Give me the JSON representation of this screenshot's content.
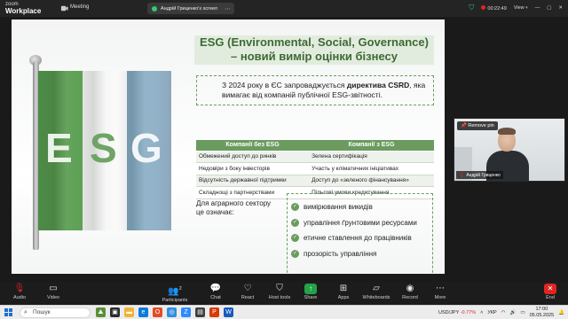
{
  "app": {
    "logo_line1": "zoom",
    "logo_line2": "Workplace",
    "meeting_label": "Meeting",
    "share_tab_label": "Андрій Гриценко's screen",
    "timer": "00:22:49",
    "view_label": "View",
    "colors": {
      "share_green": "#22a34a",
      "end_red": "#e02424",
      "accent_green": "#6b9b5f"
    }
  },
  "slide": {
    "title_line1": "ESG (Environmental, Social, Governance)",
    "title_line2": "– новий вимір оцінки бізнесу",
    "callout_pre": "З 2024 року в ЄС запроваджується ",
    "callout_bold": "директива CSRD",
    "callout_post": ", яка вимагає від компаній публічної ESG-звітності.",
    "flag_letters": [
      "E",
      "S",
      "G"
    ],
    "table": {
      "headers": [
        "Компанії без ESG",
        "Компанії з ESG"
      ],
      "rows": [
        [
          "Обмежений доступ до ринків",
          "Зелена сертифікація"
        ],
        [
          "Недовіри з боку інвесторів",
          "Участь у кліматичних ініціативах"
        ],
        [
          "Відсутність державної підтримки",
          "Доступ до «зеленого фінансування»"
        ],
        [
          "Складнощі з партнерствами",
          "Пільгові умови кредитування"
        ]
      ]
    },
    "agro_label": "Для аграрного сектору це означає:",
    "bullets": [
      "вимірювання викидів",
      "управління ґрунтовими ресурсами",
      "етичне ставлення до працівників",
      "прозорість управління"
    ]
  },
  "video": {
    "pin_label": "Remove pin",
    "name": "Андрій Гриценко"
  },
  "toolbar": {
    "items": [
      {
        "label": "Audio",
        "icon": "microphone-icon"
      },
      {
        "label": "Video",
        "icon": "camera-icon"
      },
      {
        "label": "Participants",
        "icon": "people-icon",
        "count": "2"
      },
      {
        "label": "Chat",
        "icon": "chat-icon"
      },
      {
        "label": "React",
        "icon": "heart-icon"
      },
      {
        "label": "Host tools",
        "icon": "shield-icon"
      },
      {
        "label": "Share",
        "icon": "share-icon"
      },
      {
        "label": "Apps",
        "icon": "apps-icon"
      },
      {
        "label": "Whiteboards",
        "icon": "whiteboard-icon"
      },
      {
        "label": "Record",
        "icon": "record-icon"
      },
      {
        "label": "More",
        "icon": "more-icon"
      },
      {
        "label": "End",
        "icon": "end-icon"
      }
    ]
  },
  "taskbar": {
    "search_placeholder": "Пошук",
    "ticker_symbol": "USD/JPY",
    "ticker_change": "-0.77%",
    "language": "УКР",
    "time": "17:00",
    "date": "05.05.2025"
  }
}
